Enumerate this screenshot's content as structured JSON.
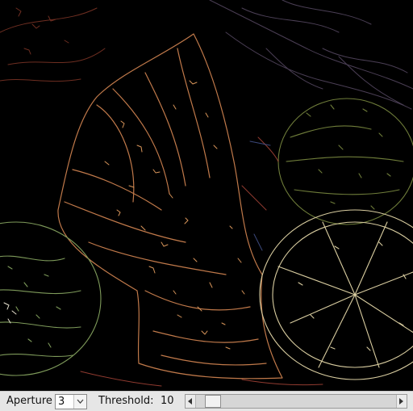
{
  "canvas": {
    "image_name": "edge-detection-output"
  },
  "controls": {
    "aperture_label": "Aperture",
    "aperture_value": "3",
    "threshold_label": "Threshold:",
    "threshold_value": "10",
    "threshold_fraction": 0.05
  }
}
